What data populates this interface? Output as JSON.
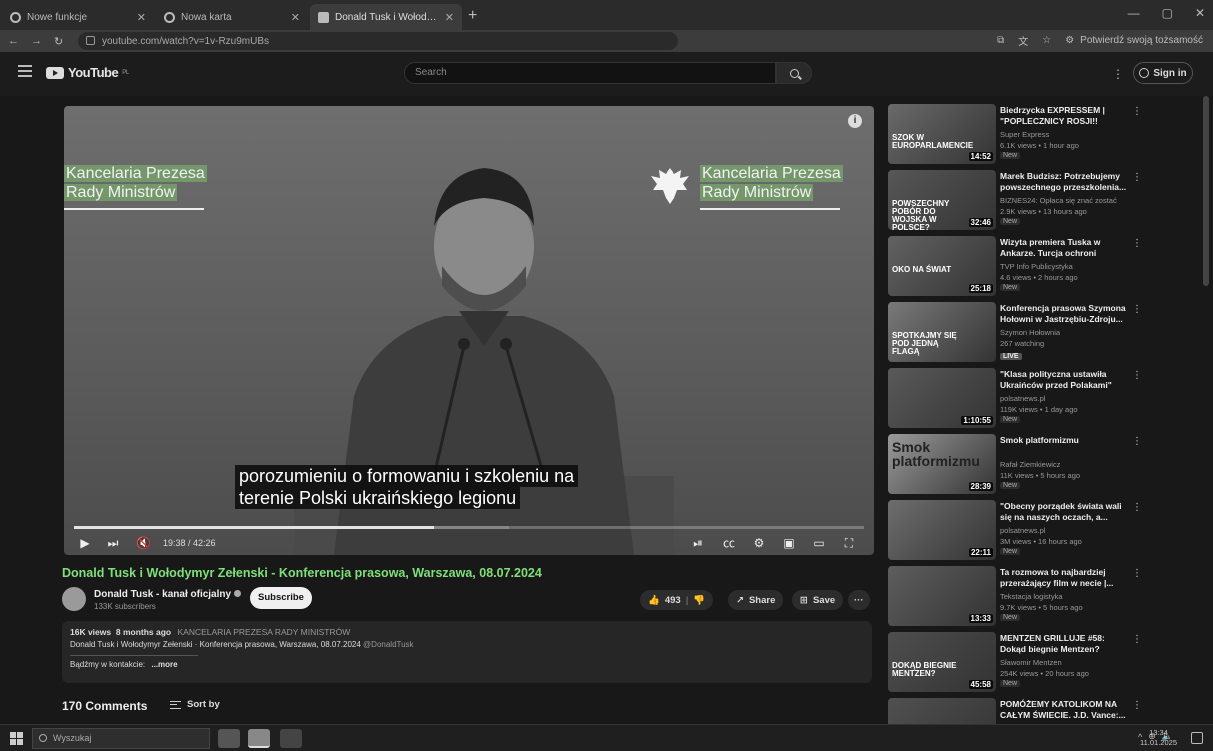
{
  "browser": {
    "tabs": [
      {
        "title": "Nowe funkcje",
        "icon": "chrome-icon"
      },
      {
        "title": "Nowa karta",
        "icon": "chrome-icon"
      },
      {
        "title": "Donald Tusk i Wołodymyr Zełe...",
        "icon": "youtube-icon"
      }
    ],
    "new_tab": "+",
    "url": "youtube.com/watch?v=1v-Rzu9mUBs",
    "profile_label": "Potwierdź swoją tożsamość"
  },
  "youtube": {
    "logo_text": "YouTube",
    "logo_region": "PL",
    "search_placeholder": "Search",
    "signin_label": "Sign in"
  },
  "player": {
    "watermark_left": [
      "Kancelaria Prezesa",
      "Rady Ministrów"
    ],
    "watermark_right": [
      "Kancelaria Prezesa",
      "Rady Ministrów"
    ],
    "subtitle_lines": [
      "porozumieniu o formowaniu i szkoleniu na",
      "terenie Polski ukraińskiego legionu"
    ],
    "time": "19:38 / 42:26",
    "progress": 0.456
  },
  "video": {
    "title": "Donald Tusk i Wołodymyr Zełenski - Konferencja prasowa, Warszawa, 08.07.2024",
    "channel": "Donald Tusk - kanał oficjalny",
    "subscribers": "133K subscribers",
    "subscribe_label": "Subscribe",
    "likes": "493",
    "share_label": "Share",
    "save_label": "Save",
    "more_label": "···",
    "description": {
      "views": "16K views",
      "age": "8 months ago",
      "tag": "KANCELARIA PREZESA RADY MINISTRÓW",
      "line2": "Donald Tusk i Wołodymyr Zełenski · Konferencja prasowa, Warszawa, 08.07.2024",
      "handle": "@DonaldTusk",
      "line3": "Bądźmy w kontakcie:",
      "more": "...more"
    },
    "comments_count": "170 Comments",
    "sort_label": "Sort by"
  },
  "recommended": [
    {
      "title": "Biedrzycka EXPRESSEM | \"POPLECZNICY ROSJI!! KONIE...",
      "channel": "Super Express",
      "meta": "6.1K views • 1 hour ago",
      "badge": "New",
      "duration": "14:52",
      "thumb_text": "SZOK W EUROPARLAMENCIE"
    },
    {
      "title": "Marek Budzisz: Potrzebujemy powszechnego przeszkolenia...",
      "channel": "BIZNES24: Opłaca się znać zostać",
      "meta": "2.9K views • 13 hours ago",
      "badge": "New",
      "duration": "32:46",
      "thumb_text": "POWSZECHNY POBÓR DO WOJSKA W POLSCE?"
    },
    {
      "title": "Wizyta premiera Tuska w Ankarze. Turcja ochroni Europ...",
      "channel": "TVP Info Publicystyka",
      "meta": "4.6 views • 2 hours ago",
      "badge": "New",
      "duration": "25:18",
      "thumb_text": "OKO NA ŚWIAT"
    },
    {
      "title": "Konferencja prasowa Szymona Hołowni w Jastrzębiu-Zdroju...",
      "channel": "Szymon Hołownia",
      "meta": "267 watching",
      "badge": "LIVE",
      "duration": "",
      "thumb_text": "SPOTKAJMY SIĘ POD JEDNĄ FLAGĄ"
    },
    {
      "title": "\"Klasa polityczna ustawiła Ukraińców przed Polakami\"",
      "channel": "polsatnews.pl",
      "meta": "119K views • 1 day ago",
      "badge": "New",
      "duration": "1:10:55",
      "thumb_text": ""
    },
    {
      "title": "Smok platformizmu",
      "channel": "Rafał Ziemkiewicz",
      "meta": "11K views • 5 hours ago",
      "badge": "New",
      "duration": "28:39",
      "thumb_text": "Smok platformizmu"
    },
    {
      "title": "\"Obecny porządek świata wali się na naszych oczach, a...",
      "channel": "polsatnews.pl",
      "meta": "3M views • 16 hours ago",
      "badge": "New",
      "duration": "22:11",
      "thumb_text": ""
    },
    {
      "title": "Ta rozmowa to najbardziej przerażający film w necie |...",
      "channel": "Tekstacja logistyka",
      "meta": "9.7K views • 5 hours ago",
      "badge": "New",
      "duration": "13:33",
      "thumb_text": ""
    },
    {
      "title": "MENTZEN GRILLUJE #58: Dokąd biegnie Mentzen?",
      "channel": "Sławomir Mentzen",
      "meta": "254K views • 20 hours ago",
      "badge": "New",
      "duration": "45:58",
      "thumb_text": "DOKĄD BIEGNIE MENTZEN?"
    },
    {
      "title": "POMÓŻEMY KATOLIKOM NA CAŁYM ŚWIECIE. J.D. Vance:...",
      "channel": "",
      "meta": "",
      "badge": "",
      "duration": "",
      "thumb_text": "POMÓŻEMY KATOLIKOM NA"
    }
  ],
  "taskbar": {
    "search_placeholder": "Wyszukaj",
    "time": "13:34",
    "date": "11.01.2025"
  }
}
